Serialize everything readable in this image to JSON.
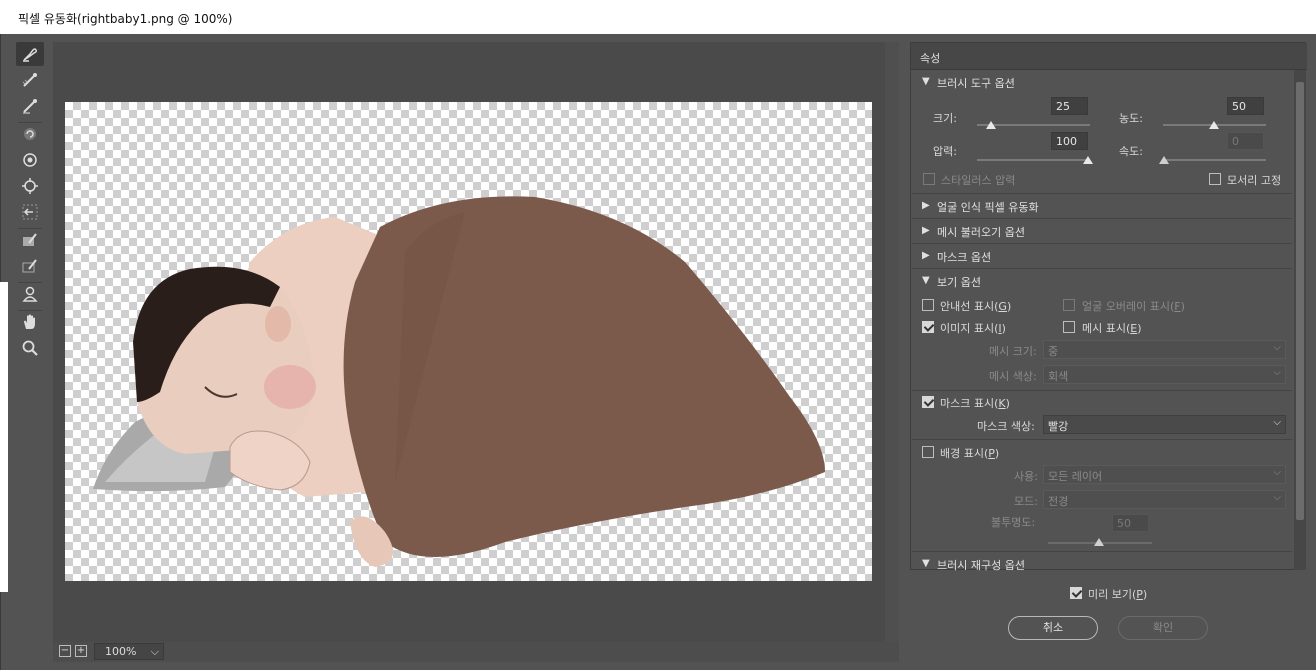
{
  "window": {
    "title": "픽셀 유동화(rightbaby1.png @ 100%)"
  },
  "status": {
    "zoom": "100%",
    "zoom_out": "−",
    "zoom_in": "+"
  },
  "panel": {
    "title": "속성",
    "brush_tool": {
      "header": "브러시 도구 옵션",
      "size_label": "크기:",
      "size": "25",
      "density_label": "농도:",
      "density": "50",
      "pressure_label": "압력:",
      "pressure": "100",
      "rate_label": "속도:",
      "rate": "0",
      "stylus_label": "스타일러스 압력",
      "pin_edges_label": "모서리 고정"
    },
    "sections": {
      "face_aware": "얼굴 인식 픽셀 유동화",
      "load_mesh": "메시 불러오기 옵션",
      "mask": "마스크 옵션",
      "view": "보기 옵션",
      "reconstruct": "브러시 재구성 옵션"
    },
    "view": {
      "guides": "안내선 표시",
      "guides_key": "G",
      "face_overlay": "얼굴 오버레이 표시",
      "face_overlay_key": "F",
      "image": "이미지 표시",
      "image_key": "I",
      "mesh": "메시 표시",
      "mesh_key": "E",
      "mesh_size_label": "메시 크기:",
      "mesh_size": "중",
      "mesh_color_label": "메시 색상:",
      "mesh_color": "회색",
      "show_mask": "마스크 표시",
      "show_mask_key": "K",
      "mask_color_label": "마스크 색상:",
      "mask_color": "빨강",
      "backdrop": "배경 표시",
      "backdrop_key": "P",
      "use_label": "사용:",
      "use": "모든 레이어",
      "mode_label": "모드:",
      "mode": "전경",
      "opacity_label": "불투명도:",
      "opacity": "50"
    }
  },
  "footer": {
    "preview": "미리 보기",
    "preview_key": "P",
    "cancel": "취소",
    "ok": "확인"
  }
}
